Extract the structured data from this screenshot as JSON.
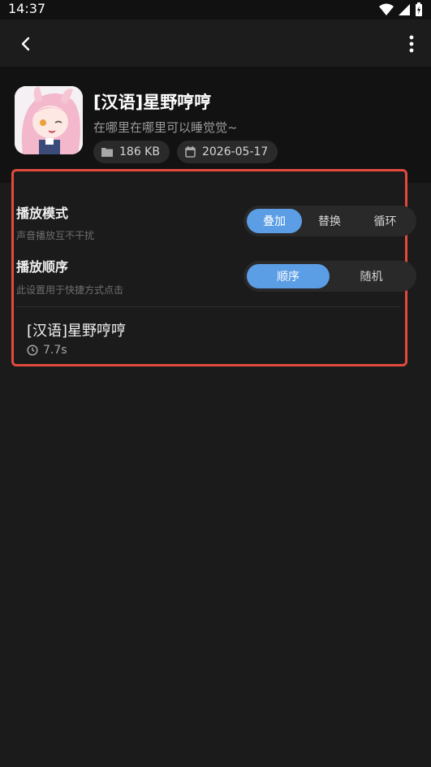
{
  "status_bar": {
    "time": "14:37"
  },
  "top_bar": {
    "back_icon": "chevron-left-icon",
    "more_icon": "more-vertical-icon"
  },
  "sound": {
    "title": "[汉语]星野哼哼",
    "subtitle": "在哪里在哪里可以睡觉觉~",
    "size": "186 KB",
    "date": "2026-05-17"
  },
  "settings": {
    "play_mode": {
      "title": "播放模式",
      "desc": "声音播放互不干扰",
      "options": [
        "叠加",
        "替换",
        "循环"
      ],
      "selected": "叠加"
    },
    "play_order": {
      "title": "播放顺序",
      "desc": "此设置用于快捷方式点击",
      "options": [
        "顺序",
        "随机"
      ],
      "selected": "顺序"
    }
  },
  "item": {
    "name": "[汉语]星野哼哼",
    "duration": "7.7s"
  },
  "colors": {
    "accent": "#5b9ee6",
    "highlight_border": "#e14a3c",
    "background": "#1b1b1c"
  }
}
